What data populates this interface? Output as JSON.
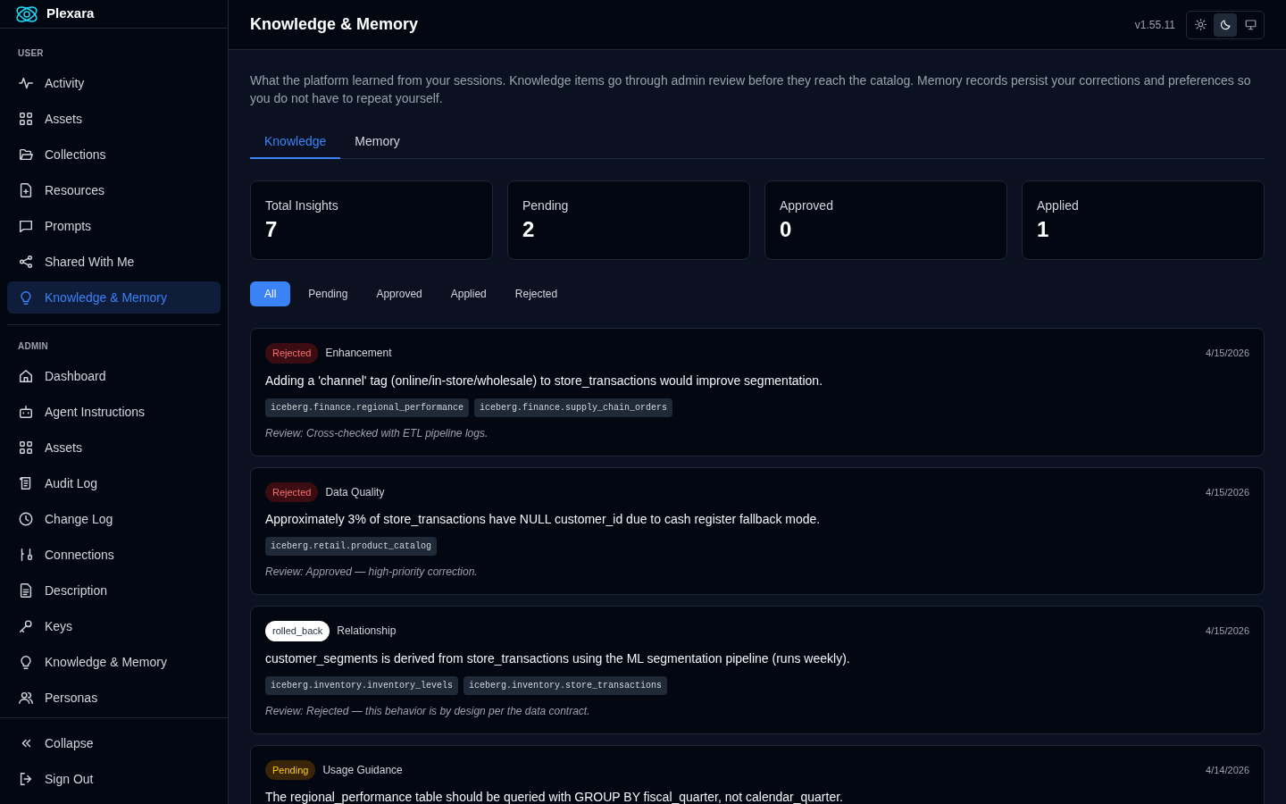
{
  "brand": {
    "name": "Plexara"
  },
  "sidebar": {
    "sections": [
      {
        "heading": "USER",
        "items": [
          {
            "label": "Activity",
            "selected": false
          },
          {
            "label": "Assets",
            "selected": false
          },
          {
            "label": "Collections",
            "selected": false
          },
          {
            "label": "Resources",
            "selected": false
          },
          {
            "label": "Prompts",
            "selected": false
          },
          {
            "label": "Shared With Me",
            "selected": false
          },
          {
            "label": "Knowledge & Memory",
            "selected": true
          }
        ]
      },
      {
        "heading": "ADMIN",
        "items": [
          {
            "label": "Dashboard",
            "selected": false
          },
          {
            "label": "Agent Instructions",
            "selected": false
          },
          {
            "label": "Assets",
            "selected": false
          },
          {
            "label": "Audit Log",
            "selected": false
          },
          {
            "label": "Change Log",
            "selected": false
          },
          {
            "label": "Connections",
            "selected": false
          },
          {
            "label": "Description",
            "selected": false
          },
          {
            "label": "Keys",
            "selected": false
          },
          {
            "label": "Knowledge & Memory",
            "selected": false
          },
          {
            "label": "Personas",
            "selected": false
          }
        ]
      }
    ],
    "footer": [
      "Collapse",
      "Sign Out"
    ]
  },
  "header": {
    "title": "Knowledge & Memory",
    "version": "v1.55.11",
    "themes": [
      {
        "kind": "light",
        "selected": false
      },
      {
        "kind": "dark",
        "selected": true
      },
      {
        "kind": "system",
        "selected": false
      }
    ]
  },
  "description": "What the platform learned from your sessions. Knowledge items go through admin review before they reach the catalog. Memory records persist your corrections and preferences so you do not have to repeat yourself.",
  "tabs": [
    {
      "label": "Knowledge",
      "selected": true
    },
    {
      "label": "Memory",
      "selected": false
    }
  ],
  "stats": [
    {
      "label": "Total Insights",
      "value": "7"
    },
    {
      "label": "Pending",
      "value": "2"
    },
    {
      "label": "Approved",
      "value": "0"
    },
    {
      "label": "Applied",
      "value": "1"
    }
  ],
  "filters": [
    {
      "label": "All",
      "selected": true
    },
    {
      "label": "Pending",
      "selected": false
    },
    {
      "label": "Approved",
      "selected": false
    },
    {
      "label": "Applied",
      "selected": false
    },
    {
      "label": "Rejected",
      "selected": false
    }
  ],
  "insights": [
    {
      "status": "Rejected",
      "kind": "rejected",
      "category": "Enhancement",
      "date": "4/15/2026",
      "text": "Adding a 'channel' tag (online/in-store/wholesale) to store_transactions would improve segmentation.",
      "tags": [
        "iceberg.finance.regional_performance",
        "iceberg.finance.supply_chain_orders"
      ],
      "review": "Review: Cross-checked with ETL pipeline logs."
    },
    {
      "status": "Rejected",
      "kind": "rejected",
      "category": "Data Quality",
      "date": "4/15/2026",
      "text": "Approximately 3% of store_transactions have NULL customer_id due to cash register fallback mode.",
      "tags": [
        "iceberg.retail.product_catalog"
      ],
      "review": "Review: Approved — high-priority correction."
    },
    {
      "status": "rolled_back",
      "kind": "rolled_back",
      "category": "Relationship",
      "date": "4/15/2026",
      "text": "customer_segments is derived from store_transactions using the ML segmentation pipeline (runs weekly).",
      "tags": [
        "iceberg.inventory.inventory_levels",
        "iceberg.inventory.store_transactions"
      ],
      "review": "Review: Rejected — this behavior is by design per the data contract."
    },
    {
      "status": "Pending",
      "kind": "pending",
      "category": "Usage Guidance",
      "date": "4/14/2026",
      "text": "The regional_performance table should be queried with GROUP BY fiscal_quarter, not calendar_quarter."
    }
  ]
}
